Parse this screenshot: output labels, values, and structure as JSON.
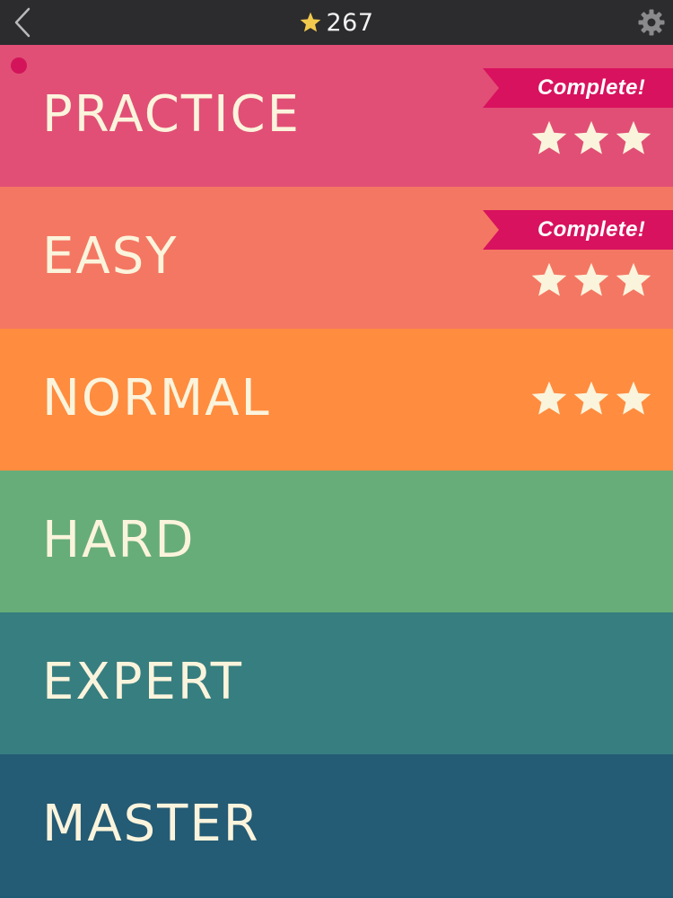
{
  "header": {
    "score": "267",
    "back_icon": "chevron-left-icon",
    "settings_icon": "gear-icon",
    "score_icon": "star-icon",
    "colors": {
      "bar": "#2c2b2e",
      "score_star": "#f2c94c"
    }
  },
  "levels": [
    {
      "label": "PRACTICE",
      "color": "#e14f76",
      "badge": "Complete!",
      "stars": 3,
      "new_dot": true
    },
    {
      "label": "EASY",
      "color": "#f47763",
      "badge": "Complete!",
      "stars": 3,
      "new_dot": false
    },
    {
      "label": "NORMAL",
      "color": "#ff8c3f",
      "badge": "",
      "stars": 3,
      "new_dot": false
    },
    {
      "label": "HARD",
      "color": "#67ad79",
      "badge": "",
      "stars": 0,
      "new_dot": false
    },
    {
      "label": "EXPERT",
      "color": "#377e80",
      "badge": "",
      "stars": 0,
      "new_dot": false
    },
    {
      "label": "MASTER",
      "color": "#245b75",
      "badge": "",
      "stars": 0,
      "new_dot": false
    }
  ],
  "colors": {
    "ribbon": "#d8125f",
    "star": "#fbf4dc",
    "label": "#fbf4dc"
  }
}
